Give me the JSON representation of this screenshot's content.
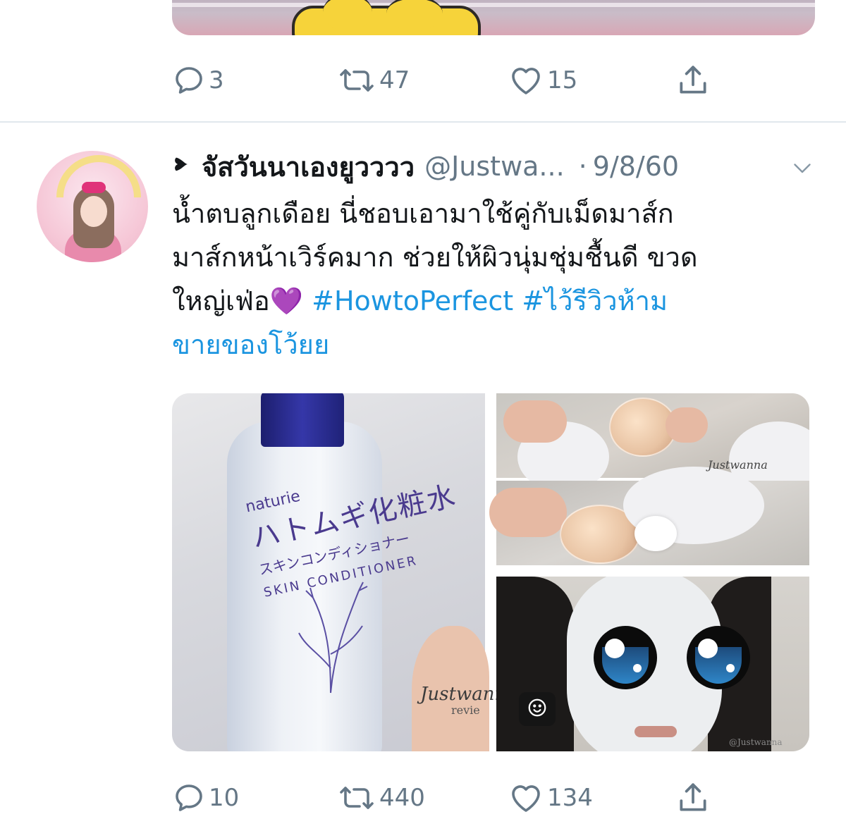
{
  "previous_tweet": {
    "actions": {
      "reply_count": "3",
      "retweet_count": "47",
      "like_count": "15"
    }
  },
  "tweet": {
    "display_name": "จัสวันนาเองยูวววว",
    "handle": "@Justwa...",
    "separator": "·",
    "date": "9/8/60",
    "text": {
      "line1": "น้ำตบลูกเดือย นี่ชอบเอามาใช้คู่กับเม็ดมาส์ก",
      "line2": "มาส์กหน้าเวิร์คมาก ช่วยให้ผิวนุ่มชุ่มชื้นดี ขวด",
      "line3_text": "ใหญ่เฟ่อ",
      "emoji": "💜",
      "hashtag1": "#HowtoPerfect",
      "hashtag2_part1": "#ไว้รีวิวห้าม",
      "hashtag2_part2": "ขายของโว้ยย"
    },
    "media": {
      "bottle_brand": "naturie",
      "bottle_title": "ハトムギ化粧水",
      "bottle_subtitle": "スキンコンディショナー",
      "bottle_english": "SKIN CONDITIONER",
      "watermark_main": "Justwann",
      "watermark_sub": "revie",
      "watermark_small": "Justwanna",
      "watermark_handle": "@Justwanna"
    },
    "actions": {
      "reply_count": "10",
      "retweet_count": "440",
      "like_count": "134"
    }
  },
  "colors": {
    "text_primary": "#14171a",
    "text_secondary": "#657786",
    "link": "#1b95e0",
    "divider": "#e1e8ed"
  },
  "icons": [
    "reply-icon",
    "retweet-icon",
    "like-icon",
    "share-icon",
    "chevron-down-icon",
    "heart-marker-icon",
    "sticker-icon"
  ]
}
